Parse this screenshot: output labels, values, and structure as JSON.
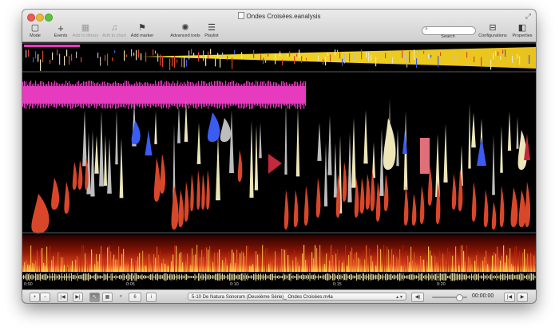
{
  "window": {
    "title": "Ondes Croisées.eanalysis"
  },
  "toolbar": {
    "mode": {
      "label": "Mode",
      "icon": "square-icon"
    },
    "events": {
      "label": "Events",
      "icon": "plus-icon"
    },
    "add_to_library": {
      "label": "Add to library",
      "icon": "library-icon"
    },
    "add_to_chart": {
      "label": "Add to chart",
      "icon": "chart-icon"
    },
    "add_marker": {
      "label": "Add marker",
      "icon": "flag-icon"
    },
    "advanced_tools": {
      "label": "Advanced tools",
      "icon": "gear-icon"
    },
    "playlist": {
      "label": "Playlist",
      "icon": "list-icon"
    },
    "search": {
      "label": "Search",
      "placeholder": "",
      "value": ""
    },
    "configurations": {
      "label": "Configurations",
      "icon": "configurations-icon"
    },
    "properties": {
      "label": "Properties",
      "icon": "properties-icon"
    }
  },
  "timeline": {
    "ticks": [
      "0:00",
      "0:05",
      "0:10",
      "0:15",
      "0:20"
    ]
  },
  "bottom_bar": {
    "zoom_in": "+",
    "zoom_out": "−",
    "go_start": "|◀",
    "go_end": "▶|",
    "tool_select": "↖",
    "tool_grid": "▦",
    "magnifier": "⌕",
    "zoom_value": "6",
    "info": "i",
    "file": "5-10 De Natura Sonorum (Deuxième Série)_ Ondes Croisées.m4a",
    "volume_icon": "speaker-icon",
    "volume_level": 0.78,
    "timecode": "00:00:00",
    "prev": "|◀",
    "play": "▶"
  },
  "colors": {
    "background": "#000000",
    "pink_band": "#e63bbf",
    "yellow_band": "#f2da2b",
    "orange_shape": "#d9472a",
    "blue_shape": "#3b5cf0",
    "pale_shape": "#ece6b8",
    "grey_shape": "#bdbdbd",
    "crimson_shape": "#c4283d",
    "spectrogram_hot": "#ffcf4a",
    "spectrogram_mid": "#b8260f"
  }
}
